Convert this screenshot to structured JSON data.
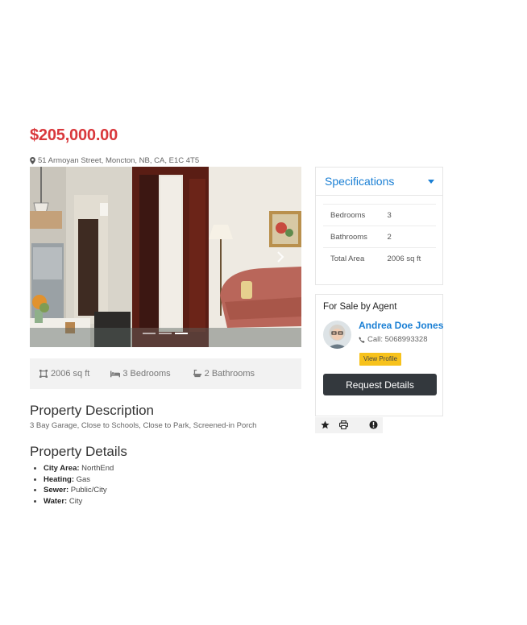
{
  "listing": {
    "price": "$205,000.00",
    "address": "51 Armoyan Street, Moncton, NB, CA, E1C 4T5"
  },
  "gallery": {
    "slides": 3,
    "active_slide": 3
  },
  "summary": {
    "area": "2006 sq ft",
    "bedrooms": "3 Bedrooms",
    "bathrooms": "2 Bathrooms"
  },
  "description": {
    "title": "Property Description",
    "text": "3 Bay Garage, Close to Schools, Close to Park, Screened-in Porch"
  },
  "details": {
    "title": "Property Details",
    "items": [
      {
        "label": "City Area:",
        "value": " NorthEnd"
      },
      {
        "label": "Heating:",
        "value": " Gas"
      },
      {
        "label": "Sewer:",
        "value": " Public/City"
      },
      {
        "label": "Water:",
        "value": " City"
      }
    ]
  },
  "specifications": {
    "title": "Specifications",
    "rows": [
      {
        "label": "Bedrooms",
        "value": "3"
      },
      {
        "label": "Bathrooms",
        "value": "2"
      },
      {
        "label": "Total Area",
        "value": "2006 sq ft"
      }
    ]
  },
  "agent": {
    "heading": "For Sale by Agent",
    "name": "Andrea Doe Jones",
    "phone": "Call: 5068993328",
    "view_profile": "View Profile",
    "request_details": "Request Details"
  },
  "tools": {
    "icons": [
      "star-icon",
      "print-icon",
      "info-icon"
    ]
  },
  "colors": {
    "price": "#d9383c",
    "accent": "#1a7fd4",
    "button_dark": "#33383d",
    "badge_yellow": "#f7c21c"
  }
}
